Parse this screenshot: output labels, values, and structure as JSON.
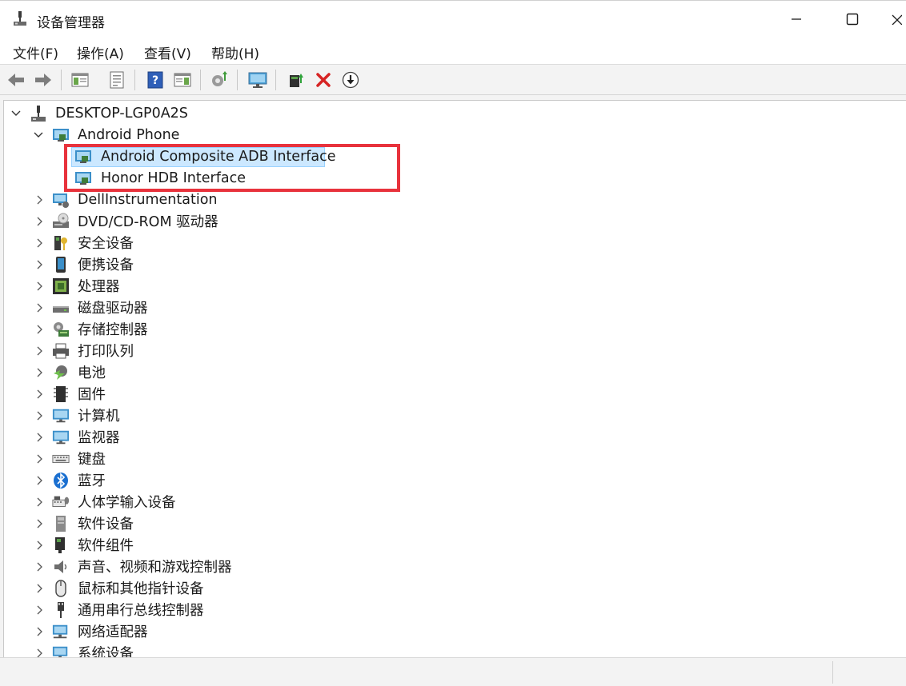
{
  "window": {
    "title": "设备管理器"
  },
  "menu": [
    "文件(F)",
    "操作(A)",
    "查看(V)",
    "帮助(H)"
  ],
  "toolbar": {
    "buttons": [
      "back-icon",
      "forward-icon",
      "show-hide-tree-icon",
      "properties-icon",
      "help-icon",
      "action-pane-icon",
      "scan-hardware-icon",
      "monitor-icon",
      "update-driver-icon",
      "uninstall-icon",
      "disable-icon"
    ],
    "accent_red": "#e8323c"
  },
  "tree": {
    "root": "DESKTOP-LGP0A2S",
    "expanded_category": "Android Phone",
    "children": [
      "Android Composite ADB Interface",
      "Honor HDB Interface"
    ],
    "categories": [
      "DellInstrumentation",
      "DVD/CD-ROM 驱动器",
      "安全设备",
      "便携设备",
      "处理器",
      "磁盘驱动器",
      "存储控制器",
      "打印队列",
      "电池",
      "固件",
      "计算机",
      "监视器",
      "键盘",
      "蓝牙",
      "人体学输入设备",
      "软件设备",
      "软件组件",
      "声音、视频和游戏控制器",
      "鼠标和其他指针设备",
      "通用串行总线控制器",
      "网络适配器",
      "系统设备"
    ],
    "selected": "Android Composite ADB Interface",
    "selection_color": "#cce8ff"
  }
}
